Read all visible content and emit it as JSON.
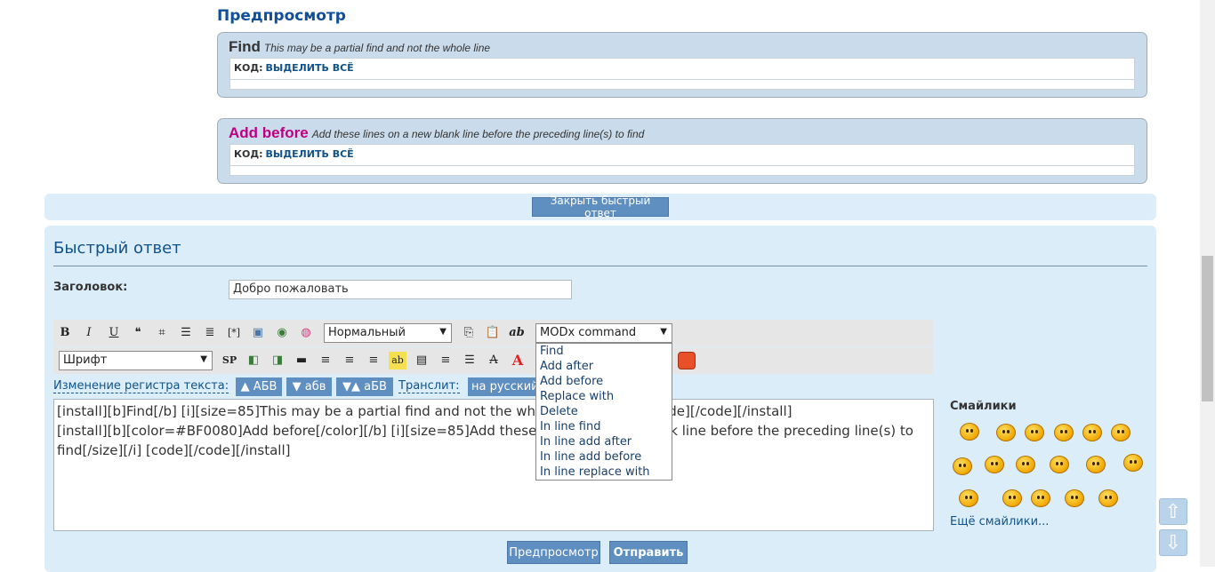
{
  "preview": {
    "title": "Предпросмотр",
    "blocks": [
      {
        "keyword": "Find",
        "keyword_color": "#333333",
        "description": "This may be a partial find and not the whole line",
        "code_label": "КОД:",
        "select_all": "ВЫДЕЛИТЬ ВСЁ"
      },
      {
        "keyword": "Add before",
        "keyword_color": "#BF0080",
        "description": "Add these lines on a new blank line before the preceding line(s) to find",
        "code_label": "КОД:",
        "select_all": "ВЫДЕЛИТЬ ВСЁ"
      }
    ]
  },
  "close_quick_reply": "Закрыть быстрый ответ",
  "quick_reply": {
    "title": "Быстрый ответ",
    "subject_label": "Заголовок:",
    "subject_value": "Добро пожаловать"
  },
  "toolbar": {
    "icons_row1": [
      {
        "name": "bold-icon",
        "glyph": "B"
      },
      {
        "name": "italic-icon",
        "glyph": "I"
      },
      {
        "name": "underline-icon",
        "glyph": "U"
      },
      {
        "name": "quote-icon",
        "glyph": "❝"
      },
      {
        "name": "code-icon",
        "glyph": "⌗"
      },
      {
        "name": "list-icon",
        "glyph": "☰"
      },
      {
        "name": "ordered-list-icon",
        "glyph": "≣"
      },
      {
        "name": "list-item-icon",
        "glyph": "[*]"
      },
      {
        "name": "image-icon",
        "glyph": "▣"
      },
      {
        "name": "url-icon",
        "glyph": "◉"
      },
      {
        "name": "color-icon",
        "glyph": "◍"
      }
    ],
    "size_select": "Нормальный",
    "icons_row1b": [
      {
        "name": "copy-icon",
        "glyph": "⎘"
      },
      {
        "name": "paste-icon",
        "glyph": "📋"
      },
      {
        "name": "spellcheck-icon",
        "glyph": "ab"
      }
    ],
    "modx_select": "MODx command",
    "modx_options": [
      "Find",
      "Add after",
      "Add before",
      "Replace with",
      "Delete",
      "In line find",
      "In line add after",
      "In line add before",
      "In line replace with"
    ],
    "font_select": "Шрифт",
    "icons_row2": [
      {
        "name": "sp-icon",
        "glyph": "SP"
      },
      {
        "name": "image-left-icon",
        "glyph": "◧"
      },
      {
        "name": "image-right-icon",
        "glyph": "◨"
      },
      {
        "name": "hr-icon",
        "glyph": "▬"
      },
      {
        "name": "align-left-icon",
        "glyph": "≡"
      },
      {
        "name": "align-center-icon",
        "glyph": "≡"
      },
      {
        "name": "align-right-icon",
        "glyph": "≡"
      },
      {
        "name": "highlight-icon",
        "glyph": "ab"
      },
      {
        "name": "justify-icon",
        "glyph": "▤"
      },
      {
        "name": "align-justify-icon",
        "glyph": "≡"
      },
      {
        "name": "indent-icon",
        "glyph": "☰"
      },
      {
        "name": "strike-icon",
        "glyph": "A"
      },
      {
        "name": "font-color-icon",
        "glyph": "A"
      }
    ]
  },
  "case_row": {
    "label": "Изменение регистра текста:",
    "upper": "▲ АБВ",
    "lower": "▼ абв",
    "toggle": "▼▲ аБВ",
    "translit_label": "Транслит:",
    "to_russian": "на русский"
  },
  "message": {
    "lines": [
      "[install][b]Find[/b] [i][size=85]This may be a partial find and not the whole line[/size][/i] [code][/code][/install]",
      "[install][b][color=#BF0080]Add before[/color][/b] [i][size=85]Add these lines on a new blank line before the preceding line(s) to",
      "find[/size][/i] [code][/code][/install]"
    ]
  },
  "smilies": {
    "title": "Смайлики",
    "more": "Ещё смайлики..."
  },
  "buttons": {
    "preview": "Предпросмотр",
    "submit": "Отправить"
  },
  "nav": {
    "up": "⇧",
    "down": "⇩"
  }
}
